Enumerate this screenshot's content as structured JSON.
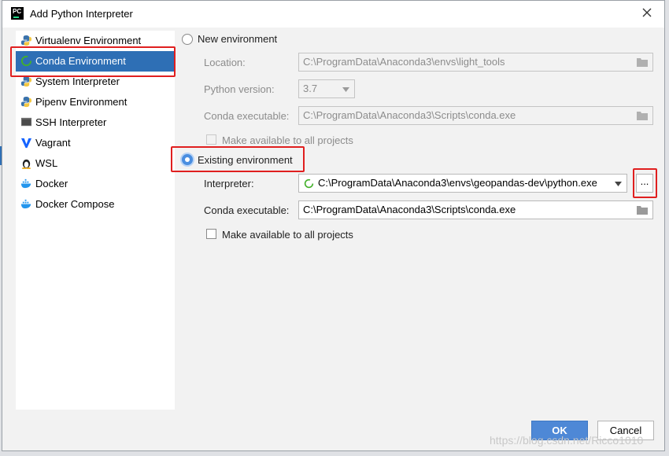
{
  "window": {
    "title": "Add Python Interpreter",
    "app_icon_text": "PC"
  },
  "sidebar": {
    "items": [
      {
        "label": "Virtualenv Environment",
        "icon": "python-icon"
      },
      {
        "label": "Conda Environment",
        "icon": "conda-icon",
        "selected": true
      },
      {
        "label": "System Interpreter",
        "icon": "python-icon"
      },
      {
        "label": "Pipenv Environment",
        "icon": "python-icon"
      },
      {
        "label": "SSH Interpreter",
        "icon": "ssh-icon"
      },
      {
        "label": "Vagrant",
        "icon": "vagrant-icon"
      },
      {
        "label": "WSL",
        "icon": "linux-icon"
      },
      {
        "label": "Docker",
        "icon": "docker-icon"
      },
      {
        "label": "Docker Compose",
        "icon": "docker-icon"
      }
    ]
  },
  "new_env": {
    "radio_label": "New environment",
    "location_label": "Location:",
    "location_value": "C:\\ProgramData\\Anaconda3\\envs\\light_tools",
    "python_version_label": "Python version:",
    "python_version_value": "3.7",
    "conda_exec_label": "Conda executable:",
    "conda_exec_value": "C:\\ProgramData\\Anaconda3\\Scripts\\conda.exe",
    "make_available_label": "Make available to all projects"
  },
  "existing_env": {
    "radio_label": "Existing environment",
    "interpreter_label": "Interpreter:",
    "interpreter_value": "C:\\ProgramData\\Anaconda3\\envs\\geopandas-dev\\python.exe",
    "browse_label": "...",
    "conda_exec_label": "Conda executable:",
    "conda_exec_value": "C:\\ProgramData\\Anaconda3\\Scripts\\conda.exe",
    "make_available_label": "Make available to all projects"
  },
  "buttons": {
    "ok": "OK",
    "cancel": "Cancel"
  },
  "watermark": "https://blog.csdn.net/Ricco1010",
  "colors": {
    "selection": "#2e6fb5",
    "highlight": "#e01f1f",
    "primary_button": "#4e88d6"
  }
}
